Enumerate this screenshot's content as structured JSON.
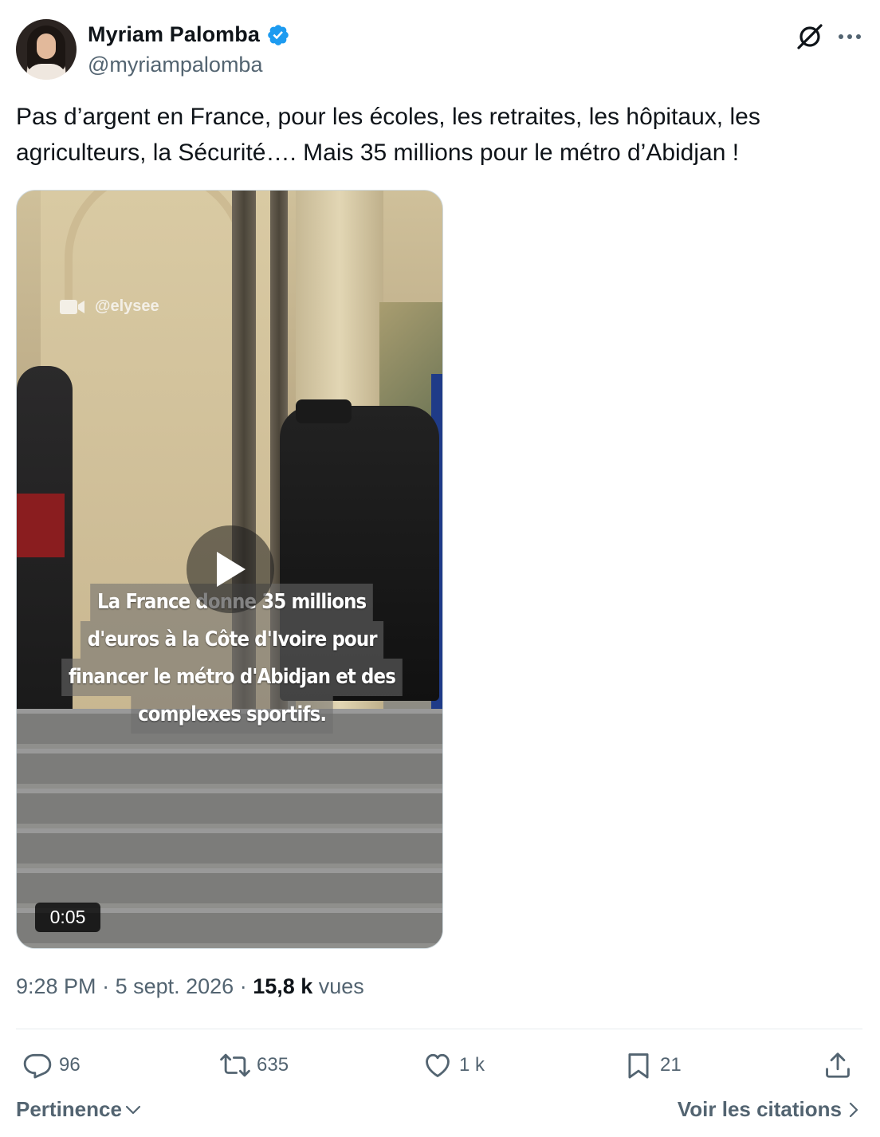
{
  "author": {
    "display_name": "Myriam Palomba",
    "handle": "@myriampalomba",
    "verified": true,
    "verified_color": "#1d9bf0"
  },
  "tweet": {
    "text": "Pas d’argent en France, pour les écoles, les retraites, les hôpitaux, les agriculteurs, la Sécurité…. Mais 35 millions pour le métro d’Abidjan !"
  },
  "video": {
    "watermark": "@elysee",
    "caption_lines": [
      "La France donne 35 millions",
      "d'euros à la Côte d'Ivoire pour",
      "financer le métro d'Abidjan et des",
      "complexes sportifs."
    ],
    "duration": "0:05"
  },
  "meta": {
    "time": "9:28 PM",
    "separator": " · ",
    "date": "5 sept. 2026",
    "views_count": "15,8 k",
    "views_label": " vues"
  },
  "actions": {
    "replies": "96",
    "reposts": "635",
    "likes": "1 k",
    "bookmarks": "21"
  },
  "footer": {
    "sort_label": "Pertinence",
    "quotes_label": "Voir les citations"
  },
  "icons": {
    "header": [
      "grok-icon",
      "more-icon"
    ],
    "actions": [
      "reply-icon",
      "repost-icon",
      "like-icon",
      "bookmark-icon",
      "share-icon"
    ]
  },
  "colors": {
    "text_primary": "#0f1419",
    "text_secondary": "#536471",
    "accent": "#1d9bf0"
  }
}
